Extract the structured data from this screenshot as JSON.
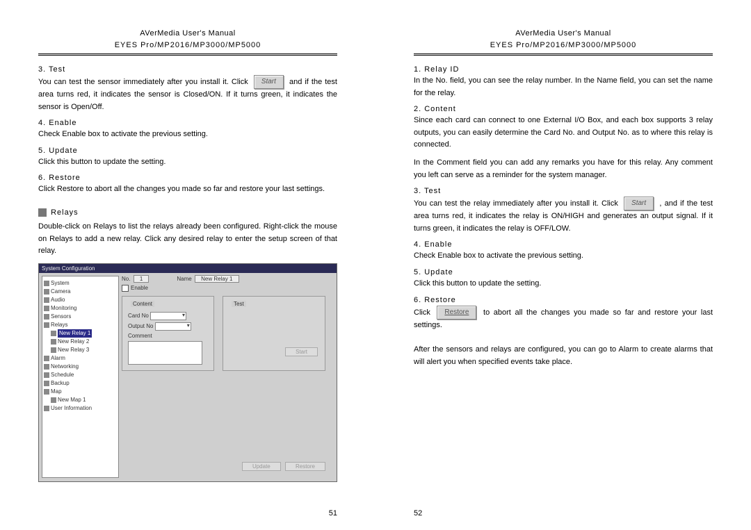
{
  "header": {
    "title": "AVerMedia User's Manual",
    "subtitle": "EYES Pro/MP2016/MP3000/MP5000"
  },
  "left": {
    "items": {
      "3": {
        "title": "3. Test",
        "body_a": "You can test the sensor immediately after you install it. Click ",
        "btn": "Start",
        "body_b": " and if the test area turns red, it indicates the sensor is Closed/ON. If it turns green, it indicates the sensor is Open/Off."
      },
      "4": {
        "title": "4. Enable",
        "body": "Check Enable box to activate the previous setting."
      },
      "5": {
        "title": "5. Update",
        "body": "Click this button to update the setting."
      },
      "6": {
        "title": "6. Restore",
        "body": "Click Restore to abort all the changes you made so far and restore your last settings."
      }
    },
    "relays_heading": "Relays",
    "relays_body": "Double-click on   Relays to list the relays already been configured. Right-click the mouse on   Relays to add a new relay. Click any desired relay to enter the setup screen of that relay.",
    "page_num": "51"
  },
  "right": {
    "items": {
      "1": {
        "title": "1. Relay ID",
        "body": "In the No. field, you can see the relay number. In the Name field, you can set the name for the relay."
      },
      "2": {
        "title": "2. Content",
        "body_a": "Since each card can connect to one External I/O Box, and each box supports 3 relay outputs, you can easily determine the Card No. and Output No. as to where this relay is connected.",
        "body_b": "In the Comment field you can add any remarks you have for this relay. Any comment you left can serve as a reminder for the system manager."
      },
      "3": {
        "title": "3. Test",
        "body_a": "You can test the relay immediately after you install it. Click ",
        "btn": "Start",
        "body_b": ", and if the test area turns red, it indicates the relay is ON/HIGH and generates an output signal. If it turns green, it indicates the relay is OFF/LOW."
      },
      "4": {
        "title": "4. Enable",
        "body": "Check Enable box to activate the previous setting."
      },
      "5": {
        "title": "5. Update",
        "body": "Click this button to update the setting."
      },
      "6": {
        "title": "6. Restore",
        "body_a": "Click ",
        "btn": "Restore",
        "body_b": " to abort all the changes you made so far and restore your last settings."
      }
    },
    "footer": "After the sensors and relays are configured, you can go to   Alarm to create alarms that will alert you when specified events take place.",
    "page_num": "52"
  },
  "screenshot": {
    "window_title": "System Configuration",
    "tree": [
      "System",
      "Camera",
      "Audio",
      "Monitoring",
      "Sensors",
      "Relays",
      "New Relay 1",
      "New Relay 2",
      "New Relay 3",
      "Alarm",
      "Networking",
      "Schedule",
      "Backup",
      "Map",
      "New Map 1",
      "User Information"
    ],
    "selected": "New Relay 1",
    "top": {
      "no_label": "No.",
      "no_value": "1",
      "name_label": "Name",
      "name_value": "New Relay 1"
    },
    "enable_label": "Enable",
    "content_group": "Content",
    "content_rows": {
      "card": "Card No",
      "output": "Output No",
      "comment": "Comment"
    },
    "test_group": "Test",
    "test_btn": "Start",
    "bottom": {
      "update": "Update",
      "restore": "Restore"
    }
  }
}
